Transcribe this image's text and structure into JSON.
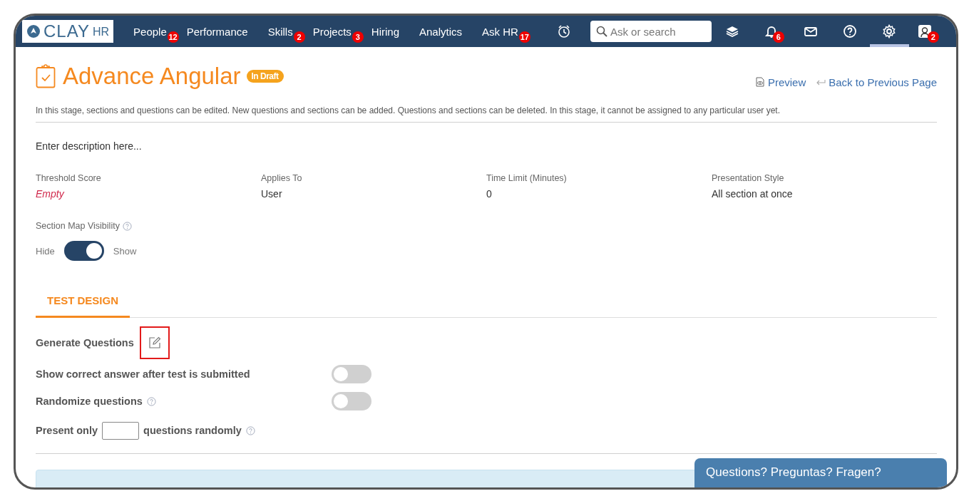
{
  "nav": {
    "logo": {
      "main": "CLAY",
      "sub": "HR"
    },
    "items": [
      {
        "label": "People",
        "badge": "12"
      },
      {
        "label": "Performance"
      },
      {
        "label": "Skills",
        "badge": "2"
      },
      {
        "label": "Projects",
        "badge": "3"
      },
      {
        "label": "Hiring"
      },
      {
        "label": "Analytics"
      },
      {
        "label": "Ask HR",
        "badge": "17"
      }
    ],
    "search": {
      "placeholder": "Ask or search"
    },
    "icons": [
      {
        "kind": "alarm",
        "selected": false
      },
      {
        "kind": "layers",
        "selected": false
      },
      {
        "kind": "bell",
        "badge": "6",
        "selected": false
      },
      {
        "kind": "mail",
        "selected": false
      },
      {
        "kind": "help",
        "selected": false
      },
      {
        "kind": "settings",
        "selected": true
      },
      {
        "kind": "avatar",
        "badge": "2",
        "selected": false
      }
    ]
  },
  "header": {
    "title": "Advance Angular",
    "status": "In Draft",
    "links": [
      {
        "kind": "preview",
        "label": "Preview"
      },
      {
        "kind": "back",
        "label": "Back to Previous Page"
      }
    ],
    "note": "In this stage, sections and questions can be edited. New questions and sections can be added. Questions and sections can be deleted. In this stage, it cannot be assigned to any particular user yet."
  },
  "description": "Enter description here...",
  "fields": [
    {
      "label": "Threshold Score",
      "value": "Empty",
      "empty": true
    },
    {
      "label": "Applies To",
      "value": "User",
      "empty": false
    },
    {
      "label": "Time Limit (Minutes)",
      "value": "0",
      "empty": false
    },
    {
      "label": "Presentation Style",
      "value": "All section at once",
      "empty": false
    }
  ],
  "section_map": {
    "label": "Section Map Visibility",
    "off_label": "Hide",
    "on_label": "Show",
    "on": true
  },
  "tabs": [
    {
      "label": "TEST DESIGN",
      "selected": true
    }
  ],
  "settings": [
    {
      "kind": "action",
      "label": "Generate Questions",
      "highlighted": true
    },
    {
      "kind": "toggle",
      "label": "Show correct answer after test is submitted",
      "help": false,
      "on": false
    },
    {
      "kind": "toggle",
      "label": "Randomize questions",
      "help": true,
      "on": false
    },
    {
      "kind": "count",
      "before": "Present only",
      "after": "questions randomly",
      "help": true
    }
  ],
  "chat": {
    "label": "Questions? Preguntas? Fragen?"
  }
}
